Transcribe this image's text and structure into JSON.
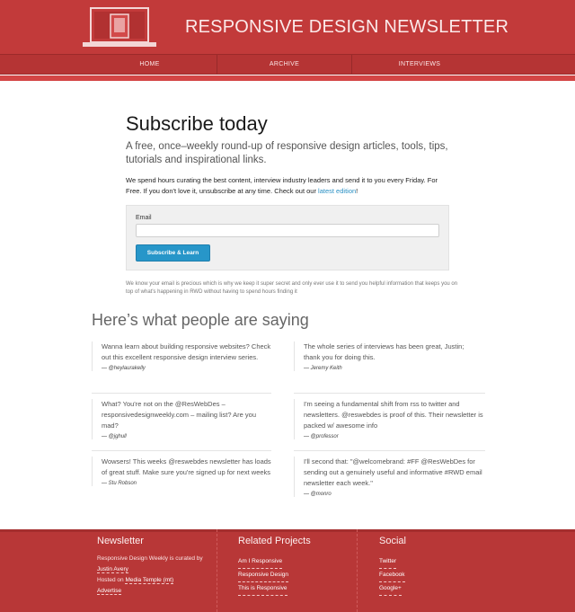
{
  "header": {
    "title": "RESPONSIVE DESIGN NEWSLETTER",
    "logo_icon": "laptop-phone-icon"
  },
  "nav": {
    "items": [
      "HOME",
      "ARCHIVE",
      "INTERVIEWS"
    ]
  },
  "main": {
    "heading": "Subscribe today",
    "lead": "A free, once–weekly round-up of responsive design articles, tools, tips, tutorials and inspirational links.",
    "body_part1": "We spend hours curating the best content, interview industry leaders and send it to you every Friday. For Free. If you don't love it, unsubscribe at any time. Check out our ",
    "body_link": "latest edition",
    "body_part2": "!",
    "form": {
      "email_label": "Email",
      "email_value": "",
      "email_placeholder": "",
      "submit_label": "Subscribe & Learn"
    },
    "privacy": "We know your email is precious which is why we keep it super secret and only ever use it to send you helpful information that keeps you on top of what's happening in RWD without having to spend hours finding it"
  },
  "testimonials": {
    "heading": "Here’s what people are saying",
    "items": [
      {
        "quote": "Wanna learn about building responsive websites? Check out this excellent responsive design interview series.",
        "author": "— @heylaurakelly"
      },
      {
        "quote": "The whole series of interviews has been great, Justin; thank you for doing this.",
        "author": "— Jeremy Keith"
      },
      {
        "quote": "What? You're not on the @ResWebDes – responsivedesignweekly.com – mailing list? Are you mad?",
        "author": "— @jghull"
      },
      {
        "quote": "I'm seeing a fundamental shift from rss to twitter and newsletters. @reswebdes is proof of this. Their newsletter is packed w/ awesome info",
        "author": "— @professor"
      },
      {
        "quote": "Wowsers! This weeks @reswebdes newsletter has loads of great stuff. Make sure you're signed up for next weeks",
        "author": "— Stu Robson"
      },
      {
        "quote": "I'll second that: \"@welcomebrand: #FF @ResWebDes for sending out a genuinely useful and informative #RWD email newsletter each week.\"",
        "author": "— @monro"
      }
    ]
  },
  "footer": {
    "newsletter": {
      "title": "Newsletter",
      "curated_text": "Responsive Design Weekly is curated by ",
      "curator_link": "Justin Avery",
      "hosted_text": "Hosted on ",
      "host_link": "Media Temple (mt)",
      "advertise_link": "Advertise"
    },
    "related": {
      "title": "Related Projects",
      "links": [
        "Am I Responsive",
        "Responsive Design",
        "This is Responsive"
      ]
    },
    "social": {
      "title": "Social",
      "links": [
        "Twitter",
        "Facebook",
        "Google+"
      ]
    }
  },
  "colors": {
    "brand_red": "#c23a3a",
    "accent_blue": "#2796c9"
  }
}
